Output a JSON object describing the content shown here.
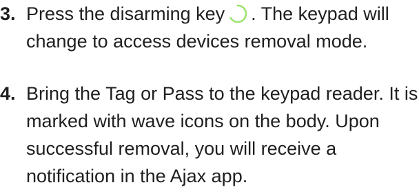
{
  "steps": [
    {
      "number": "3.",
      "text_before_icon": "Press the disarming key",
      "icon": "disarm-ring-icon",
      "icon_color": "#9be36c",
      "text_after_icon": ". The keypad will change to access devices removal mode."
    },
    {
      "number": "4.",
      "text": "Bring the Tag or Pass to the keypad reader. It is marked with wave icons on the body. Upon successful removal, you will receive a notification in the Ajax app."
    }
  ]
}
